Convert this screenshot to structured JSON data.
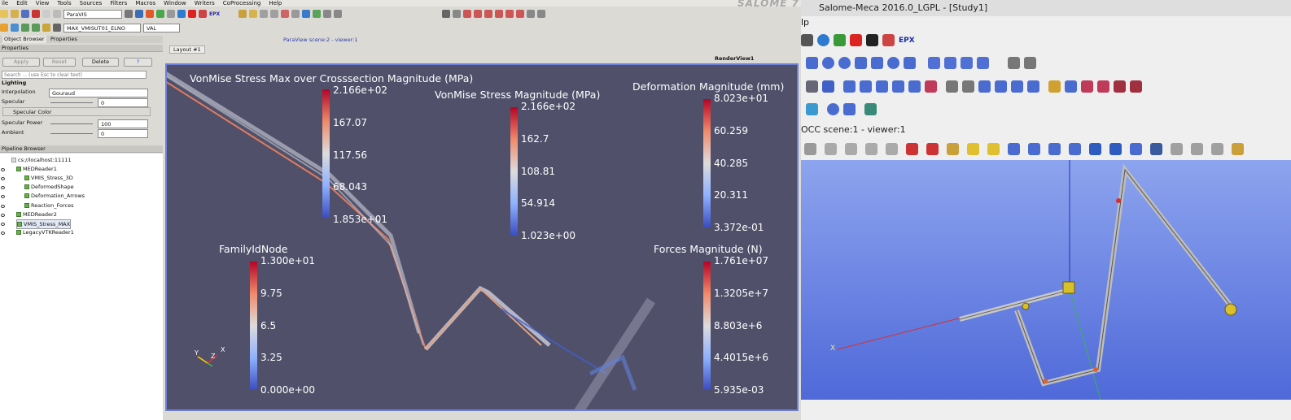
{
  "menu": [
    "ile",
    "Edit",
    "View",
    "Tools",
    "Sources",
    "Filters",
    "Macros",
    "Window",
    "Writers",
    "CoProcessing",
    "Help"
  ],
  "brand": "SALOME 7",
  "toolbar": {
    "view_combo": "ParaVIS",
    "array_combo": "MAX_VMISUT01_ELNO",
    "component_combo": "VAL"
  },
  "tabs": {
    "object_browser": "Object Browser",
    "properties": "Properties"
  },
  "properties": {
    "header": "Properties",
    "apply": "Apply",
    "reset": "Reset",
    "delete": "Delete",
    "help": "?",
    "search_placeholder": "Search ... (use Esc to clear text)",
    "section": "Lighting",
    "interpolation_label": "Interpolation",
    "interpolation_value": "Gouraud",
    "specular_label": "Specular",
    "specular_value": "0",
    "specular_color_label": "Specular Color",
    "specular_power_label": "Specular Power",
    "specular_power_value": "100",
    "ambient_label": "Ambient",
    "ambient_value": "0"
  },
  "pipeline": {
    "header": "Pipeline Browser",
    "items": [
      "cs://localhost:11111",
      "MEDReader1",
      "VMIS_Stress_3D",
      "DeformedShape",
      "Deformation_Arrows",
      "Reaction_Forces",
      "MEDReader2",
      "VMIS_Stress_MAX",
      "LegacyVTKReader1"
    ]
  },
  "scene_title": "ParaView scene:2 - viewer:1",
  "layout_tab": "Layout #1",
  "render_view": "RenderView1",
  "colorbars": [
    {
      "title": "VonMise Stress Max over Crosssection Magnitude (MPa)",
      "labels": [
        "2.166e+02",
        "167.07",
        "117.56",
        "68.043",
        "1.853e+01"
      ]
    },
    {
      "title": "VonMise Stress Magnitude (MPa)",
      "labels": [
        "2.166e+02",
        "162.7",
        "108.81",
        "54.914",
        "1.023e+00"
      ]
    },
    {
      "title": "Deformation Magnitude (mm)",
      "labels": [
        "8.023e+01",
        "60.259",
        "40.285",
        "20.311",
        "3.372e-01"
      ]
    },
    {
      "title": "FamilyIdNode",
      "labels": [
        "1.300e+01",
        "9.75",
        "6.5",
        "3.25",
        "0.000e+00"
      ]
    },
    {
      "title": "Forces Magnitude (N)",
      "labels": [
        "1.761e+07",
        "1.3205e+7",
        "8.803e+6",
        "4.4015e+6",
        "5.935e-03"
      ]
    }
  ],
  "axes_labels": {
    "y": "Y",
    "z": "Z",
    "x": "X"
  },
  "right": {
    "window_title": "Salome-Meca 2016.0_LGPL - [Study1]",
    "menu_fragment": "lp",
    "epx_label": "EPX",
    "occ_title": "OCC scene:1 - viewer:1",
    "axis_label": "X"
  },
  "colors": {
    "viewer_bg": "#50506a",
    "occ_top": "#8da4ee",
    "occ_bottom": "#4f69d9",
    "accent": "#6e7fd9"
  }
}
